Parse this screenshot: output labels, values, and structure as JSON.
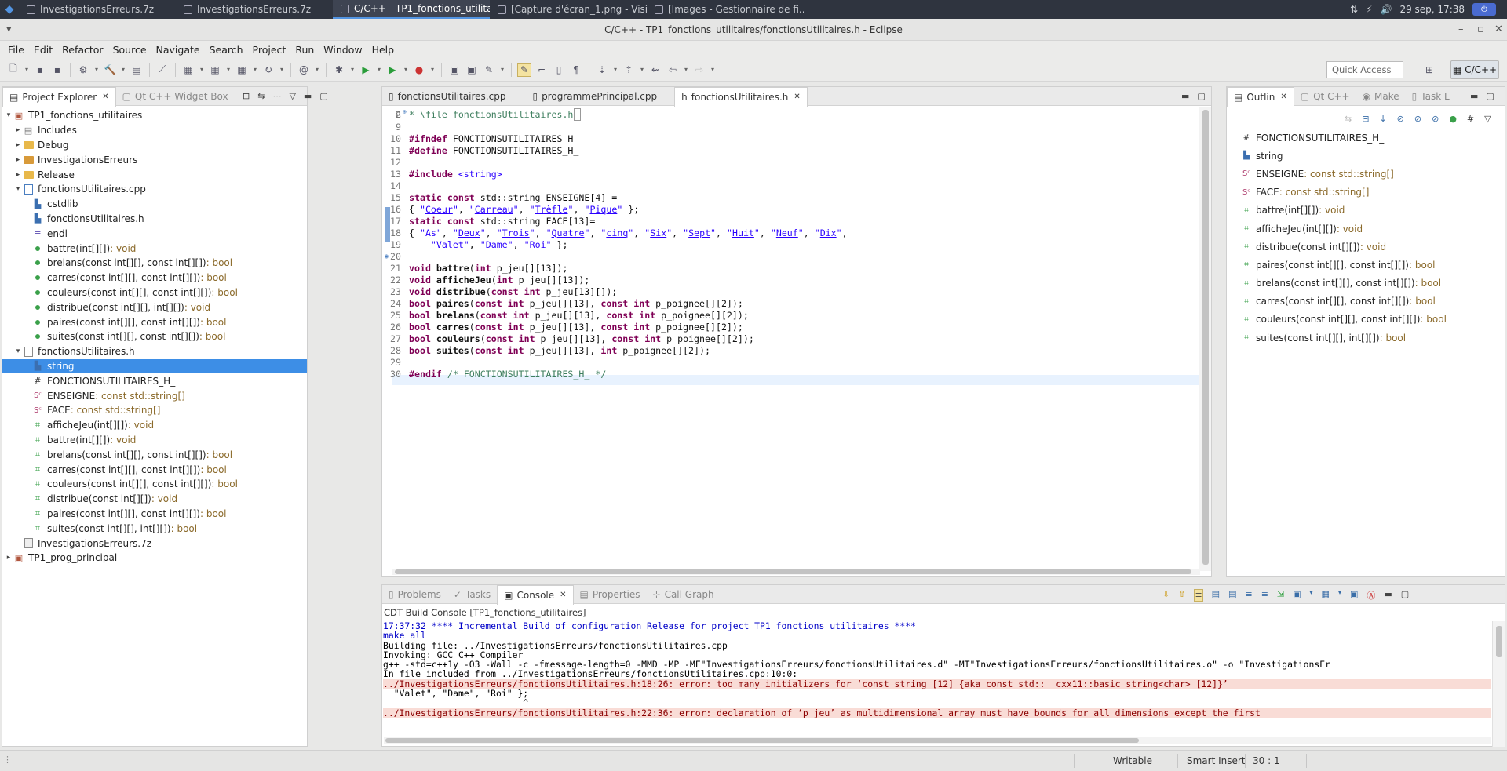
{
  "taskbar": {
    "tasks": [
      {
        "label": "InvestigationsErreurs.7z",
        "active": false
      },
      {
        "label": "InvestigationsErreurs.7z",
        "active": false
      },
      {
        "label": "C/C++ - TP1_fonctions_utilitai...",
        "active": true
      },
      {
        "label": "[Capture d'écran_1.png - Visi...",
        "active": false
      },
      {
        "label": "[Images - Gestionnaire de fi...",
        "active": false
      }
    ],
    "clock": "29 sep, 17:38"
  },
  "window": {
    "title": "C/C++ - TP1_fonctions_utilitaires/fonctionsUtilitaires.h - Eclipse"
  },
  "menu": [
    "File",
    "Edit",
    "Refactor",
    "Source",
    "Navigate",
    "Search",
    "Project",
    "Run",
    "Window",
    "Help"
  ],
  "toolbar": {
    "quick_access_placeholder": "Quick Access",
    "perspective": "C/C++"
  },
  "explorer": {
    "tabs": [
      "Project Explorer",
      "Qt C++ Widget Box"
    ],
    "rows": [
      {
        "label": "TP1_fonctions_utilitaires",
        "type": ""
      },
      {
        "label": "Includes",
        "type": ""
      },
      {
        "label": "Debug",
        "type": ""
      },
      {
        "label": "InvestigationsErreurs",
        "type": ""
      },
      {
        "label": "Release",
        "type": ""
      },
      {
        "label": "fonctionsUtilitaires.cpp",
        "type": ""
      },
      {
        "label": "cstdlib",
        "type": ""
      },
      {
        "label": "fonctionsUtilitaires.h",
        "type": ""
      },
      {
        "label": "endl",
        "type": ""
      },
      {
        "label": "battre(int[][]) ",
        "type": ": void"
      },
      {
        "label": "brelans(const int[][], const int[][]) ",
        "type": ": bool"
      },
      {
        "label": "carres(const int[][], const int[][]) ",
        "type": ": bool"
      },
      {
        "label": "couleurs(const int[][], const int[][]) ",
        "type": ": bool"
      },
      {
        "label": "distribue(const int[][], int[][]) ",
        "type": ": void"
      },
      {
        "label": "paires(const int[][], const int[][]) ",
        "type": ": bool"
      },
      {
        "label": "suites(const int[][], const int[][]) ",
        "type": ": bool"
      },
      {
        "label": "fonctionsUtilitaires.h",
        "type": ""
      },
      {
        "label": "string",
        "type": ""
      },
      {
        "label": "FONCTIONSUTILITAIRES_H_",
        "type": ""
      },
      {
        "label": "ENSEIGNE ",
        "type": ": const std::string[]"
      },
      {
        "label": "FACE ",
        "type": ": const std::string[]"
      },
      {
        "label": "afficheJeu(int[][]) ",
        "type": ": void"
      },
      {
        "label": "battre(int[][]) ",
        "type": ": void"
      },
      {
        "label": "brelans(const int[][], const int[][]) ",
        "type": ": bool"
      },
      {
        "label": "carres(const int[][], const int[][]) ",
        "type": ": bool"
      },
      {
        "label": "couleurs(const int[][], const int[][]) ",
        "type": ": bool"
      },
      {
        "label": "distribue(const int[][]) ",
        "type": ": void"
      },
      {
        "label": "paires(const int[][], const int[][]) ",
        "type": ": bool"
      },
      {
        "label": "suites(const int[][], int[][]) ",
        "type": ": bool"
      },
      {
        "label": "InvestigationsErreurs.7z",
        "type": ""
      },
      {
        "label": "TP1_prog_principal",
        "type": ""
      }
    ]
  },
  "editor": {
    "tabs": [
      "fonctionsUtilitaires.cpp",
      "programmePrincipal.cpp",
      "fonctionsUtilitaires.h"
    ],
    "line_numbers": [
      "2",
      "8",
      "9",
      "10",
      "11",
      "12",
      "13",
      "14",
      "15",
      "16",
      "17",
      "18",
      "19",
      "20",
      "21",
      "22",
      "23",
      "24",
      "25",
      "26",
      "27",
      "28",
      "29",
      "30"
    ]
  },
  "outline": {
    "tabs": [
      "Outlin",
      "Qt C++",
      "Make",
      "Task L"
    ],
    "items": [
      {
        "label": "FONCTIONSUTILITAIRES_H_",
        "type": ""
      },
      {
        "label": "string",
        "type": ""
      },
      {
        "label": "ENSEIGNE",
        "type": " : const std::string[]"
      },
      {
        "label": "FACE",
        "type": " : const std::string[]"
      },
      {
        "label": "battre(int[][])",
        "type": " : void"
      },
      {
        "label": "afficheJeu(int[][])",
        "type": " : void"
      },
      {
        "label": "distribue(const int[][])",
        "type": " : void"
      },
      {
        "label": "paires(const int[][], const int[][])",
        "type": " : bool"
      },
      {
        "label": "brelans(const int[][], const int[][])",
        "type": " : bool"
      },
      {
        "label": "carres(const int[][], const int[][])",
        "type": " : bool"
      },
      {
        "label": "couleurs(const int[][], const int[][])",
        "type": " : bool"
      },
      {
        "label": "suites(const int[][], int[][])",
        "type": " : bool"
      }
    ]
  },
  "console": {
    "tabs": [
      "Problems",
      "Tasks",
      "Console",
      "Properties",
      "Call Graph"
    ],
    "title": "CDT Build Console [TP1_fonctions_utilitaires]",
    "lines": [
      {
        "text": "17:37:32 **** Incremental Build of configuration Release for project TP1_fonctions_utilitaires ****",
        "kind": "blue"
      },
      {
        "text": "make all",
        "kind": "blue"
      },
      {
        "text": "Building file: ../InvestigationsErreurs/fonctionsUtilitaires.cpp",
        "kind": ""
      },
      {
        "text": "Invoking: GCC C++ Compiler",
        "kind": ""
      },
      {
        "text": "g++ -std=c++1y -O3 -Wall -c -fmessage-length=0 -MMD -MP -MF\"InvestigationsErreurs/fonctionsUtilitaires.d\" -MT\"InvestigationsErreurs/fonctionsUtilitaires.o\" -o \"InvestigationsEr",
        "kind": ""
      },
      {
        "text": "In file included from ../InvestigationsErreurs/fonctionsUtilitaires.cpp:10:0:",
        "kind": ""
      },
      {
        "text": "../InvestigationsErreurs/fonctionsUtilitaires.h:18:26: error: too many initializers for ‘const string [12] {aka const std::__cxx11::basic_string<char> [12]}’",
        "kind": "err"
      },
      {
        "text": "  \"Valet\", \"Dame\", \"Roi\" };",
        "kind": ""
      },
      {
        "text": "                          ^",
        "kind": ""
      },
      {
        "text": "../InvestigationsErreurs/fonctionsUtilitaires.h:22:36: error: declaration of ‘p_jeu’ as multidimensional array must have bounds for all dimensions except the first",
        "kind": "err"
      }
    ]
  },
  "status": {
    "mode": "Writable",
    "insert": "Smart Insert",
    "position": "30 : 1"
  }
}
